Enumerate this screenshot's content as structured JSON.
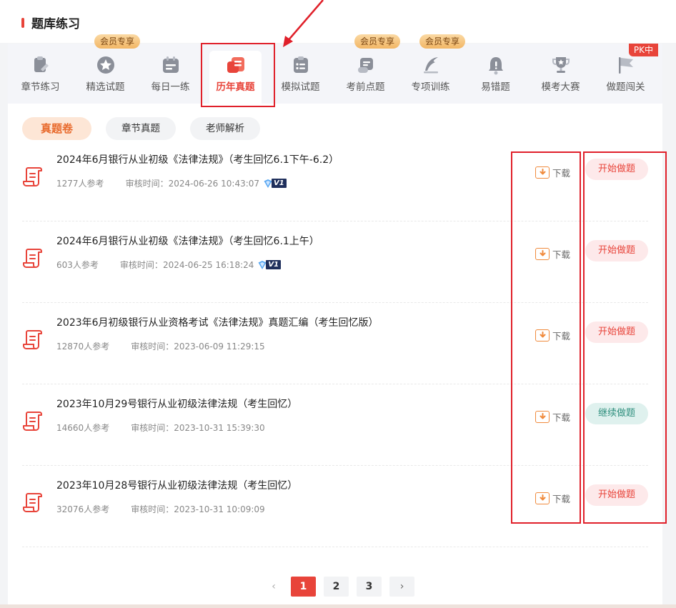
{
  "section": {
    "title": "题库练习"
  },
  "nav": [
    {
      "label": "章节练习",
      "icon": "clipboard-pen-icon"
    },
    {
      "label": "精选试题",
      "icon": "star-badge-icon",
      "tag": "会员专享"
    },
    {
      "label": "每日一练",
      "icon": "calendar-icon"
    },
    {
      "label": "历年真题",
      "icon": "paper-card-icon",
      "active": true
    },
    {
      "label": "模拟试题",
      "icon": "checklist-icon"
    },
    {
      "label": "考前点题",
      "icon": "scroll-icon",
      "tag": "会员专享"
    },
    {
      "label": "专项训练",
      "icon": "quill-icon",
      "tag": "会员专享"
    },
    {
      "label": "易错题",
      "icon": "alert-bell-icon"
    },
    {
      "label": "模考大赛",
      "icon": "trophy-icon"
    },
    {
      "label": "做题闯关",
      "icon": "flag-icon",
      "pk": "PK中"
    }
  ],
  "filters": [
    "真题卷",
    "章节真题",
    "老师解析"
  ],
  "labels": {
    "download": "下载",
    "participants_suffix": "人参考",
    "review_time_label": "审核时间："
  },
  "papers": [
    {
      "title": "2024年6月银行从业初级《法律法规》（考生回忆6.1下午-6.2）",
      "participants": "1277",
      "review_time": "2024-06-26 10:43:07",
      "badge": "V1",
      "action": "开始做题",
      "action_style": "red"
    },
    {
      "title": "2024年6月银行从业初级《法律法规》（考生回忆6.1上午）",
      "participants": "603",
      "review_time": "2024-06-25 16:18:24",
      "badge": "V1",
      "action": "开始做题",
      "action_style": "red"
    },
    {
      "title": "2023年6月初级银行从业资格考试《法律法规》真题汇编（考生回忆版）",
      "participants": "12870",
      "review_time": "2023-06-09 11:29:15",
      "badge": "",
      "action": "开始做题",
      "action_style": "red"
    },
    {
      "title": "2023年10月29号银行从业初级法律法规（考生回忆）",
      "participants": "14660",
      "review_time": "2023-10-31 15:39:30",
      "badge": "",
      "action": "继续做题",
      "action_style": "teal"
    },
    {
      "title": "2023年10月28号银行从业初级法律法规（考生回忆）",
      "participants": "32076",
      "review_time": "2023-10-31 10:09:09",
      "badge": "",
      "action": "开始做题",
      "action_style": "red"
    }
  ],
  "pagination": {
    "pages": [
      "1",
      "2",
      "3"
    ],
    "current": "1",
    "prev": "‹",
    "next": "›"
  },
  "colors": {
    "accent": "#e8443a",
    "vip_gold": "#f2b665",
    "annotation_red": "#e0202a",
    "download_orange": "#f08a3c",
    "continue_teal": "#2f8f7e"
  }
}
